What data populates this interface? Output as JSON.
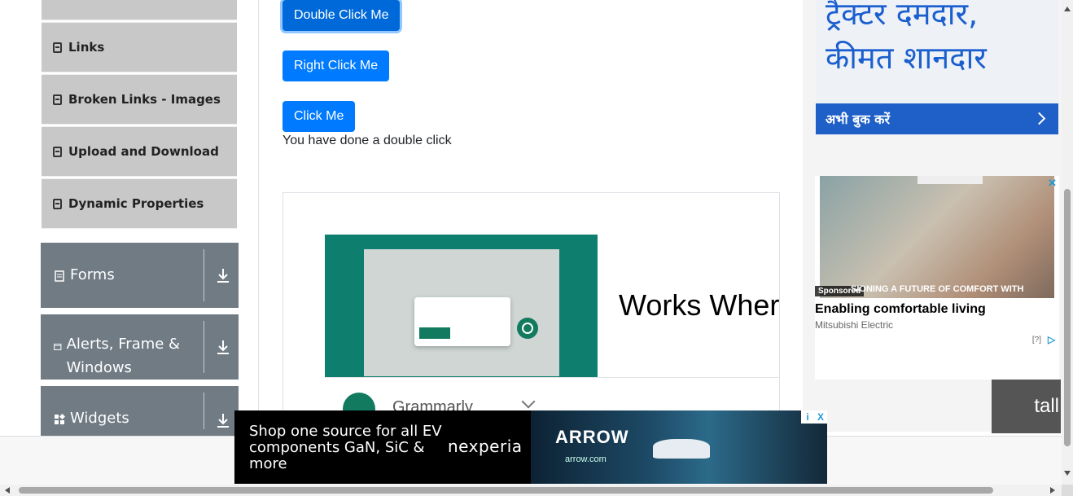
{
  "sidebar": {
    "elements_items": [
      {
        "label": "Links"
      },
      {
        "label": "Broken Links - Images"
      },
      {
        "label": "Upload and Download"
      },
      {
        "label": "Dynamic Properties"
      }
    ],
    "groups": [
      {
        "label": "Forms",
        "icon": "document-icon"
      },
      {
        "label": "Alerts, Frame & Windows",
        "icon": "window-icon"
      },
      {
        "label": "Widgets",
        "icon": "widgets-icon"
      }
    ]
  },
  "main": {
    "double_click_label": "Double Click Me",
    "right_click_label": "Right Click Me",
    "click_label": "Click Me",
    "result_message": "You have done a double click"
  },
  "grammarly_ad": {
    "headline": "Works Where Y",
    "brand": "Grammarly"
  },
  "hindi_ad": {
    "line1": "ट्रैक्टर दमदार,",
    "line2": "कीमत शानदार",
    "cta": "अभी बुक करें"
  },
  "mitsubishi_ad": {
    "sponsored": "Sponsored",
    "caption": "SIONING A FUTURE OF COMFORT WITH",
    "headline": "Enabling comfortable living",
    "advertiser": "Mitsubishi Electric",
    "help": "[?]"
  },
  "partial_right_text": "tall",
  "bottom_ad": {
    "text": "Shop one source for all EV components GaN, SiC & more",
    "logo": "nexperia",
    "partner": "ARROW",
    "url": "arrow.com",
    "info": "i",
    "close": "X"
  }
}
